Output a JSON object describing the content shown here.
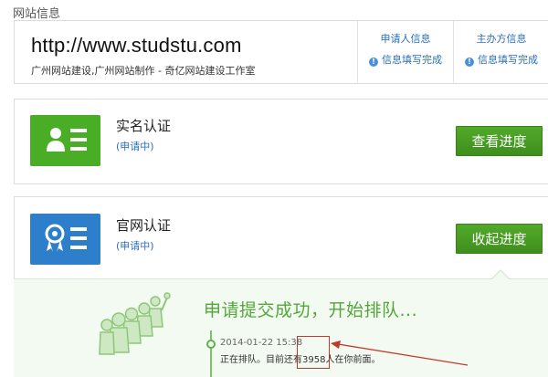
{
  "section": {
    "title": "网站信息"
  },
  "site": {
    "url": "http://www.studstu.com",
    "description": "广州网站建设,广州网站制作 - 奇亿网站建设工作室"
  },
  "info_columns": [
    {
      "header": "申请人信息",
      "status": "信息填写完成"
    },
    {
      "header": "主办方信息",
      "status": "信息填写完成"
    }
  ],
  "certs": [
    {
      "title": "实名认证",
      "status": "(申请中)",
      "button": "查看进度",
      "icon": "id-card-icon",
      "color": "#4aad26"
    },
    {
      "title": "官网认证",
      "status": "(申请中)",
      "button": "收起进度",
      "icon": "ribbon-badge-icon",
      "color": "#2d7fcb"
    }
  ],
  "progress": {
    "title": "申请提交成功，开始排队...",
    "time": "2014-01-22 15:38",
    "message": "正在排队。目前还有3958人在你前面。"
  },
  "colors": {
    "accent_green": "#52a63a",
    "link_blue": "#2a6fb8",
    "badge_blue": "#2d7fcb",
    "badge_green": "#4aad26"
  }
}
